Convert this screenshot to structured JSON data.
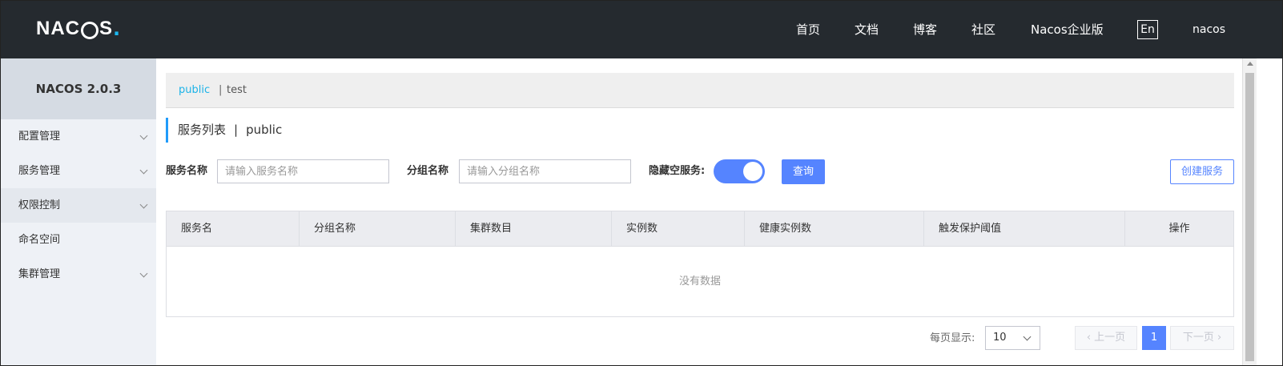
{
  "header": {
    "logo_text_left": "NAC",
    "logo_text_right": "S",
    "logo_dot": ".",
    "nav": [
      "首页",
      "文档",
      "博客",
      "社区",
      "Nacos企业版"
    ],
    "lang": "En",
    "user": "nacos"
  },
  "sidebar": {
    "title": "NACOS 2.0.3",
    "items": [
      {
        "label": "配置管理",
        "has_children": true
      },
      {
        "label": "服务管理",
        "has_children": true
      },
      {
        "label": "权限控制",
        "has_children": true
      },
      {
        "label": "命名空间",
        "has_children": false
      },
      {
        "label": "集群管理",
        "has_children": true
      }
    ]
  },
  "namespaces": {
    "active": "public",
    "separator": "|",
    "other": "test"
  },
  "page": {
    "title": "服务列表",
    "separator": "|",
    "namespace": "public"
  },
  "filters": {
    "service_label": "服务名称",
    "service_placeholder": "请输入服务名称",
    "group_label": "分组名称",
    "group_placeholder": "请输入分组名称",
    "hide_empty_label": "隐藏空服务:",
    "hide_empty_on": true,
    "query_button": "查询",
    "create_button": "创建服务"
  },
  "table": {
    "columns": [
      "服务名",
      "分组名称",
      "集群数目",
      "实例数",
      "健康实例数",
      "触发保护阈值",
      "操作"
    ],
    "rows": [],
    "empty_text": "没有数据"
  },
  "pagination": {
    "page_size_label": "每页显示:",
    "page_size": "10",
    "prev": "上一页",
    "next": "下一页",
    "current_page": "1"
  },
  "colors": {
    "header_bg": "#252a2f",
    "primary": "#5584ff",
    "link": "#1cb3e8",
    "sidebar_bg": "#eef1f6"
  }
}
